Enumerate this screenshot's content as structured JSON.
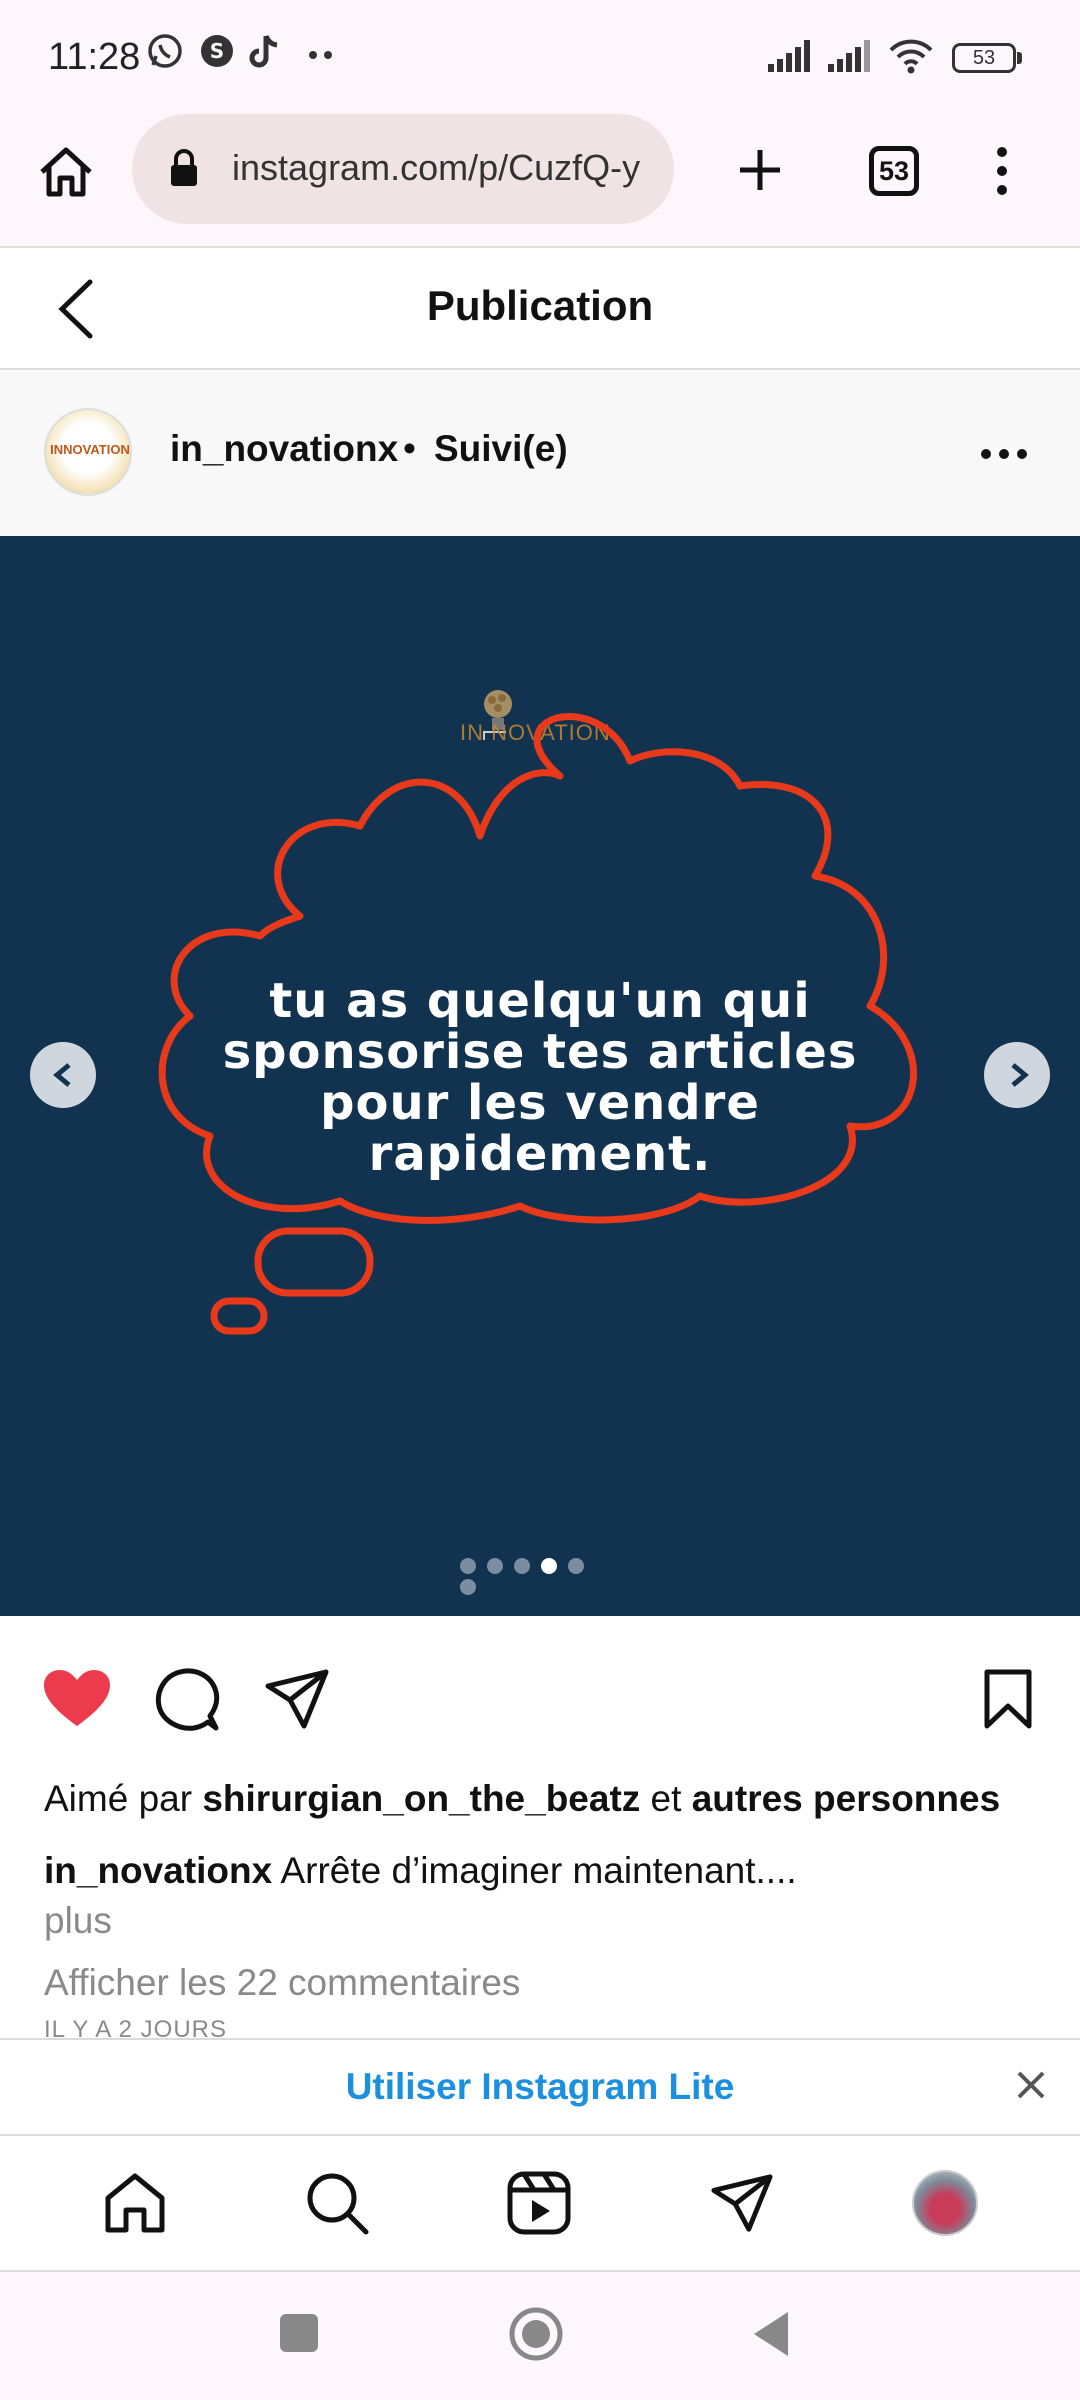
{
  "status_bar": {
    "time": "11:28",
    "icons": [
      "whatsapp-icon",
      "shazam-icon",
      "tiktok-icon",
      "more-dots-icon",
      "signal-icon",
      "signal-icon",
      "wifi-icon",
      "battery-icon"
    ],
    "battery": "53"
  },
  "browser": {
    "url": "instagram.com/p/CuzfQ-y",
    "tab_count": "53"
  },
  "header": {
    "title": "Publication"
  },
  "author": {
    "username": "in_novationx",
    "separator": "•",
    "follow_status": "Suivi(e)",
    "avatar_text": "INNOVATION"
  },
  "post": {
    "logo_text": "IN NOVATION",
    "cloud_text": "tu as quelqu'un qui sponsorise tes articles pour les vendre rapidement.",
    "background_color": "#12334f",
    "accent_color": "#e8391b",
    "carousel_total": 6,
    "carousel_active": 4
  },
  "engagement": {
    "liked_prefix": "Aimé par ",
    "liked_user": "shirurgian_on_the_beatz",
    "liked_middle": " et ",
    "liked_others": "autres personnes",
    "caption_user": "in_novationx",
    "caption_text": " Arrête d’imaginer maintenant....",
    "more_label": "plus",
    "comments_label": "Afficher les 22 commentaires",
    "time_ago": "IL Y A 2 JOURS"
  },
  "lite_banner": {
    "label": "Utiliser Instagram Lite"
  },
  "bottom_nav": [
    "home-icon",
    "search-icon",
    "reels-icon",
    "direct-icon",
    "profile-avatar"
  ],
  "colors": {
    "like": "#ed3b4e",
    "link_blue": "#1b8fe0"
  }
}
